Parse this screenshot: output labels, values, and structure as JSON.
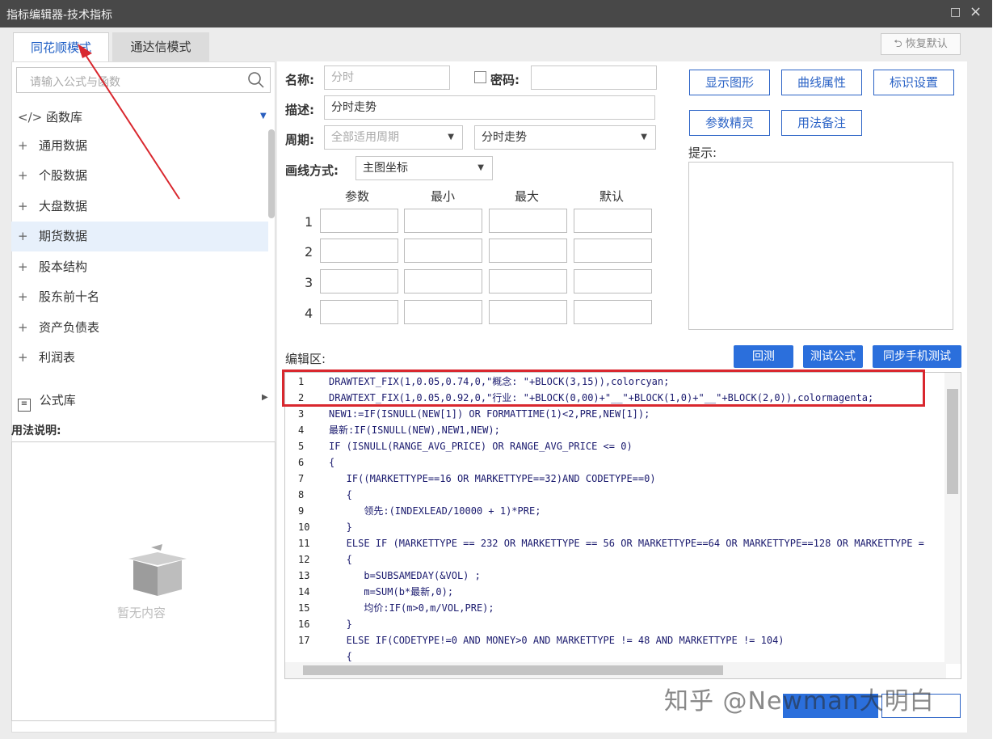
{
  "window": {
    "title": "指标编辑器-技术指标",
    "min_icon": "□",
    "close_icon": "×"
  },
  "tabs": [
    {
      "label": "同花顺模式"
    },
    {
      "label": "通达信模式"
    }
  ],
  "restore_label": "恢复默认",
  "search": {
    "placeholder": "请输入公式与函数"
  },
  "library": {
    "title": "函数库",
    "code_icon": "</>"
  },
  "library_items": [
    "通用数据",
    "个股数据",
    "大盘数据",
    "期货数据",
    "股本结构",
    "股东前十名",
    "资产负债表",
    "利润表"
  ],
  "formula_lib": "公式库",
  "usage_title": "用法说明:",
  "empty_text": "暂无内容",
  "form": {
    "name_label": "名称:",
    "name_value": "分时",
    "password_label": "密码:",
    "desc_label": "描述:",
    "desc_value": "分时走势",
    "period_label": "周期:",
    "period_value": "全部适用周期",
    "period2_value": "分时走势",
    "draw_label": "画线方式:",
    "draw_value": "主图坐标"
  },
  "param_headers": [
    "参数",
    "最小",
    "最大",
    "默认"
  ],
  "param_rows": [
    "1",
    "2",
    "3",
    "4"
  ],
  "right_buttons": [
    "显示图形",
    "曲线属性",
    "标识设置",
    "参数精灵",
    "用法备注"
  ],
  "hint_label": "提示:",
  "editor_label": "编辑区:",
  "editor_buttons": [
    "回测",
    "测试公式",
    "同步手机测试"
  ],
  "code_lines": [
    {
      "n": "1",
      "text": "DRAWTEXT_FIX(1,0.05,0.74,0,\"概念: \"+BLOCK(3,15)),colorcyan;"
    },
    {
      "n": "2",
      "text": "DRAWTEXT_FIX(1,0.05,0.92,0,\"行业: \"+BLOCK(0,00)+\"__\"+BLOCK(1,0)+\"__\"+BLOCK(2,0)),colormagenta;"
    },
    {
      "n": "3",
      "text": "NEW1:=IF(ISNULL(NEW[1]) OR FORMATTIME(1)<2,PRE,NEW[1]);"
    },
    {
      "n": "4",
      "text": "最新:IF(ISNULL(NEW),NEW1,NEW);"
    },
    {
      "n": "5",
      "text": "IF (ISNULL(RANGE_AVG_PRICE) OR RANGE_AVG_PRICE <= 0)"
    },
    {
      "n": "6",
      "text": "{"
    },
    {
      "n": "7",
      "text": "   IF((MARKETTYPE==16 OR MARKETTYPE==32)AND CODETYPE==0)"
    },
    {
      "n": "8",
      "text": "   {"
    },
    {
      "n": "9",
      "text": "      领先:(INDEXLEAD/10000 + 1)*PRE;"
    },
    {
      "n": "10",
      "text": "   }"
    },
    {
      "n": "11",
      "text": "   ELSE IF (MARKETTYPE == 232 OR MARKETTYPE == 56 OR MARKETTYPE==64 OR MARKETTYPE==128 OR MARKETTYPE ="
    },
    {
      "n": "12",
      "text": "   {"
    },
    {
      "n": "13",
      "text": "      b=SUBSAMEDAY(&VOL) ;"
    },
    {
      "n": "14",
      "text": "      m=SUM(b*最新,0);"
    },
    {
      "n": "15",
      "text": "      均价:IF(m>0,m/VOL,PRE);"
    },
    {
      "n": "16",
      "text": "   }"
    },
    {
      "n": "17",
      "text": "   ELSE IF(CODETYPE!=0 AND MONEY>0 AND MARKETTYPE != 48 AND MARKETTYPE != 104)"
    },
    {
      "n": "",
      "text": "   {"
    }
  ],
  "watermark": "知乎 @Newman大明白",
  "colors": {
    "accent": "#2b6fdc",
    "highlight": "#d9272e",
    "titlebar": "#484848"
  }
}
